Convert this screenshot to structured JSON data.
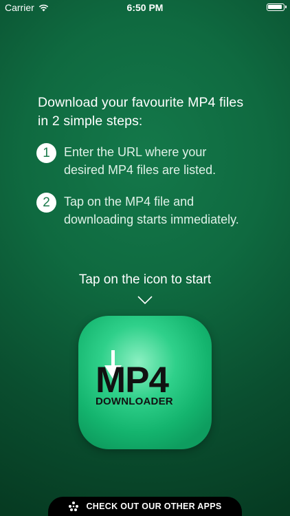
{
  "status_bar": {
    "carrier": "Carrier",
    "time": "6:50 PM",
    "wifi_icon": "wifi-icon",
    "battery_icon": "battery-icon"
  },
  "intro": {
    "line1": "Download your favourite MP4 files",
    "line2": "in 2 simple steps:"
  },
  "steps": [
    {
      "number": "1",
      "line1": "Enter the URL where your",
      "line2": "desired MP4 files are listed."
    },
    {
      "number": "2",
      "line1": "Tap on the MP4 file and",
      "line2": "downloading starts immediately."
    }
  ],
  "cta": {
    "text": "Tap on the icon to start",
    "icon": "chevron-down-icon"
  },
  "app_icon": {
    "title": "MP4",
    "subtitle": "DOWNLOADER",
    "icon": "download-arrow-icon",
    "colors": {
      "light": "#8cf0c2",
      "main": "#2fd08a",
      "dark": "#0e9d5f"
    }
  },
  "bottom_bar": {
    "label": "CHECK OUT OUR OTHER APPS",
    "icon": "apps-dots-icon"
  },
  "colors": {
    "background": "#0f6a40",
    "background_dark": "#063b22",
    "text": "#ffffff",
    "step_badge_text": "#1b7a4b"
  }
}
